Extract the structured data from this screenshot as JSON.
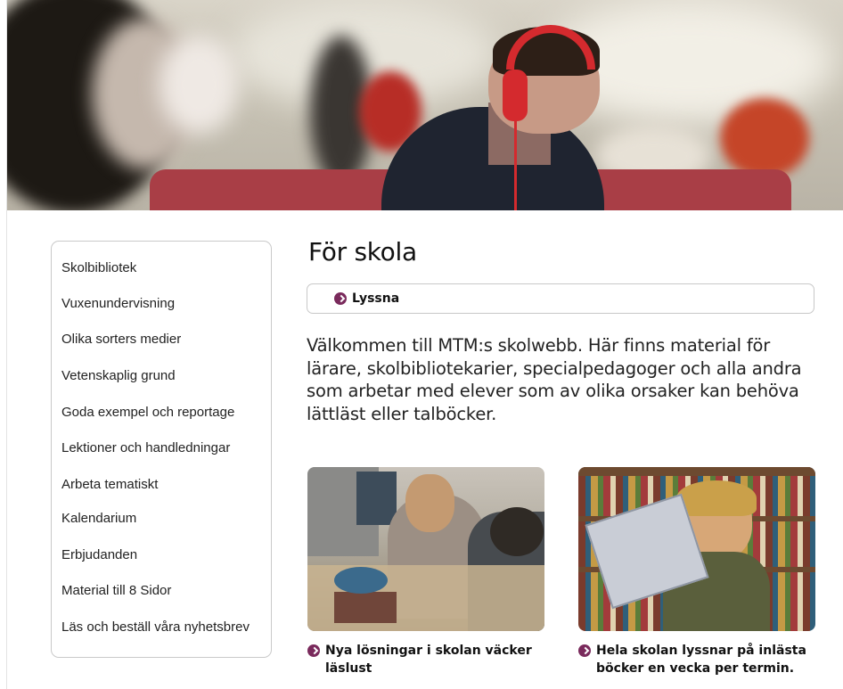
{
  "hero": {
    "alt": "Student with red headphones in a library"
  },
  "sidebar": {
    "items": [
      {
        "label": "Skolbibliotek"
      },
      {
        "label": "Vuxenundervisning"
      },
      {
        "label": "Olika sorters medier"
      },
      {
        "label": "Vetenskaplig grund"
      },
      {
        "label": "Goda exempel och reportage"
      },
      {
        "label": "Lektioner och handledningar"
      },
      {
        "label": "Arbeta tematiskt"
      },
      {
        "label": "Kalendarium"
      },
      {
        "label": "Erbjudanden"
      },
      {
        "label": "Material till 8 Sidor"
      },
      {
        "label": "Läs och beställ våra nyhetsbrev"
      }
    ]
  },
  "main": {
    "title": "För skola",
    "listen_label": "Lyssna",
    "intro": "Välkommen till MTM:s skolwebb. Här finns material för lärare, skolbibliotekarier, specialpedagoger och alla andra som arbetar med elever som av olika orsaker kan behöva lättläst eller talböcker.",
    "cards": [
      {
        "caption_line1": "Nya lösningar i skolan väcker",
        "caption_line2": "läslust"
      },
      {
        "caption_line1": "Hela skolan lyssnar på inlästa",
        "caption_line2": "böcker en vecka per termin."
      }
    ]
  },
  "colors": {
    "accent": "#7a2a5c",
    "headphones": "#d42a2e"
  }
}
